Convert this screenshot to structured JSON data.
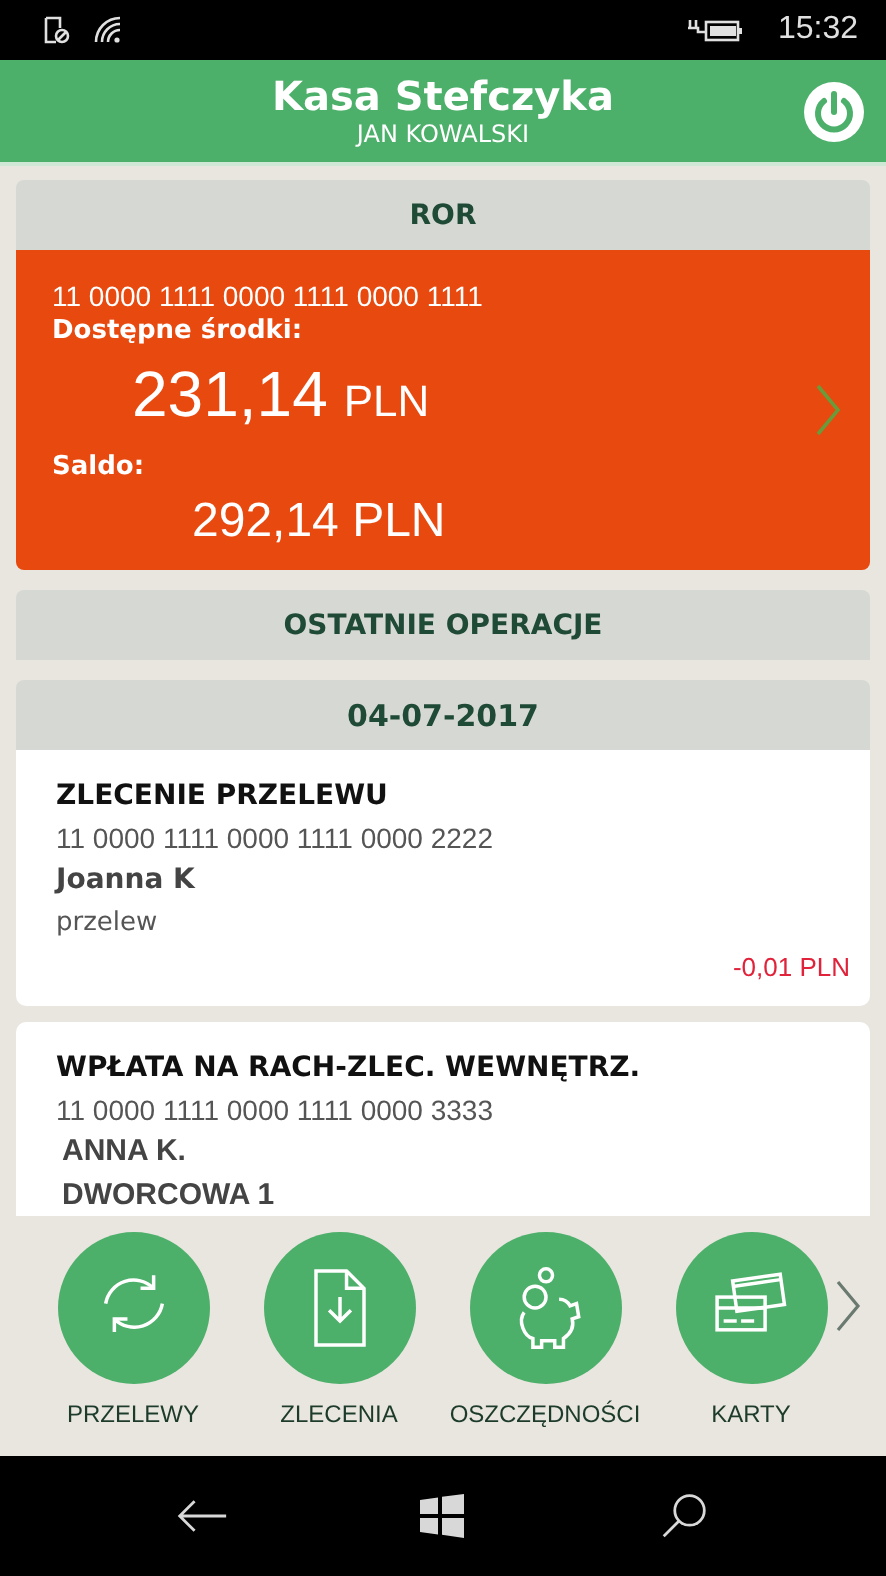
{
  "status_bar": {
    "time": "15:32"
  },
  "header": {
    "title": "Kasa Stefczyka",
    "subtitle": "JAN KOWALSKI"
  },
  "account": {
    "heading": "ROR",
    "number": "11 0000 1111 0000 1111 0000 1111",
    "available_label": "Dostępne środki:",
    "available_amount": "231,14",
    "available_currency": "PLN",
    "balance_label": "Saldo:",
    "balance_amount": "292,14 PLN"
  },
  "recent": {
    "heading": "OSTATNIE OPERACJE",
    "date": "04-07-2017",
    "operations": [
      {
        "title": "ZLECENIE PRZELEWU",
        "account": "11 0000 1111 0000 1111 0000 2222",
        "lines": [
          {
            "text": "Joanna K",
            "kind": "name"
          },
          {
            "text": "przelew",
            "kind": "note"
          }
        ],
        "amount": "-0,01 PLN"
      },
      {
        "title": "WPŁATA NA RACH-ZLEC. WEWNĘTRZ.",
        "account": "11 0000 1111 0000 1111 0000 3333",
        "lines": [
          {
            "text": "ANNA K.",
            "kind": "caps"
          },
          {
            "text": "DWORCOWA 1",
            "kind": "caps"
          }
        ]
      }
    ]
  },
  "shortcuts": [
    {
      "label": "PRZELEWY",
      "kind": "transfers"
    },
    {
      "label": "ZLECENIA",
      "kind": "orders"
    },
    {
      "label": "OSZCZĘDNOŚCI",
      "kind": "savings"
    },
    {
      "label": "KARTY",
      "kind": "cards"
    }
  ]
}
